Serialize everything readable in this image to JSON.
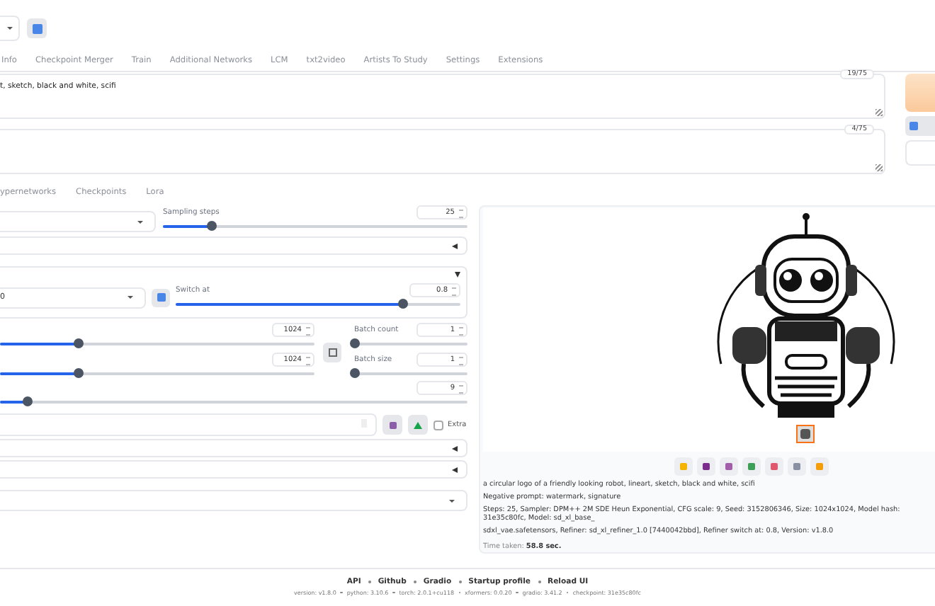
{
  "tabs": [
    {
      "label": "Info",
      "selected": false
    },
    {
      "label": "Checkpoint Merger",
      "selected": false
    },
    {
      "label": "Train",
      "selected": false
    },
    {
      "label": "Additional Networks",
      "selected": false
    },
    {
      "label": "LCM",
      "selected": false
    },
    {
      "label": "txt2video",
      "selected": false
    },
    {
      "label": "Artists To Study",
      "selected": false
    },
    {
      "label": "Settings",
      "selected": false
    },
    {
      "label": "Extensions",
      "selected": false
    }
  ],
  "prompt": {
    "value": "t, sketch, black and white, scifi",
    "token_count": "19/75"
  },
  "negative_prompt": {
    "token_count": "4/75"
  },
  "sub_tabs": [
    {
      "label": "ypernetworks",
      "selected": false
    },
    {
      "label": "Checkpoints",
      "selected": false
    },
    {
      "label": "Lora",
      "selected": false
    }
  ],
  "sampling_steps": {
    "label": "Sampling steps",
    "value": "25",
    "level": 0.16
  },
  "hires_section": {
    "expanded": false
  },
  "refiner": {
    "expanded": true,
    "checkpoint_value": "0",
    "switch_label": "Switch at",
    "switch_value": "0.8",
    "level": 0.8
  },
  "width": {
    "value": "1024",
    "level": 0.25
  },
  "height": {
    "value": "1024",
    "level": 0.25
  },
  "batch_count": {
    "label": "Batch count",
    "value": "1",
    "level": 0
  },
  "batch_size": {
    "label": "Batch size",
    "value": "1",
    "level": 0
  },
  "cfg_scale": {
    "value": "9",
    "level": 0.06
  },
  "seed": {
    "extra_label": "Extra",
    "extra_checked": false
  },
  "lower_sections": [
    {
      "expanded": false
    },
    {
      "expanded": false
    }
  ],
  "output": {
    "caption": "a circular logo of a friendly looking robot, lineart, sketch, black and white, scifi",
    "negative": "Negative prompt: watermark, signature",
    "params": "Steps: 25, Sampler: DPM++ 2M SDE Heun Exponential, CFG scale: 9, Seed: 3152806346, Size: 1024x1024, Model hash: 31e35c80fc, Model: sd_xl_base_",
    "params_2": "sdxl_vae.safetensors, Refiner: sd_xl_refiner_1.0 [7440042bbd], Refiner switch at: 0.8, Version: v1.8.0",
    "time_label": "Time taken:",
    "time_value": "58.8 sec."
  },
  "footer": {
    "links": [
      "API",
      "Github",
      "Gradio",
      "Startup profile",
      "Reload UI"
    ],
    "versions": [
      "version: v1.8.0",
      "python: 3.10.6",
      "torch: 2.0.1+cu118",
      "xformers: 0.0.20",
      "gradio: 3.41.2",
      "checkpoint: 31e35c80fc"
    ]
  }
}
